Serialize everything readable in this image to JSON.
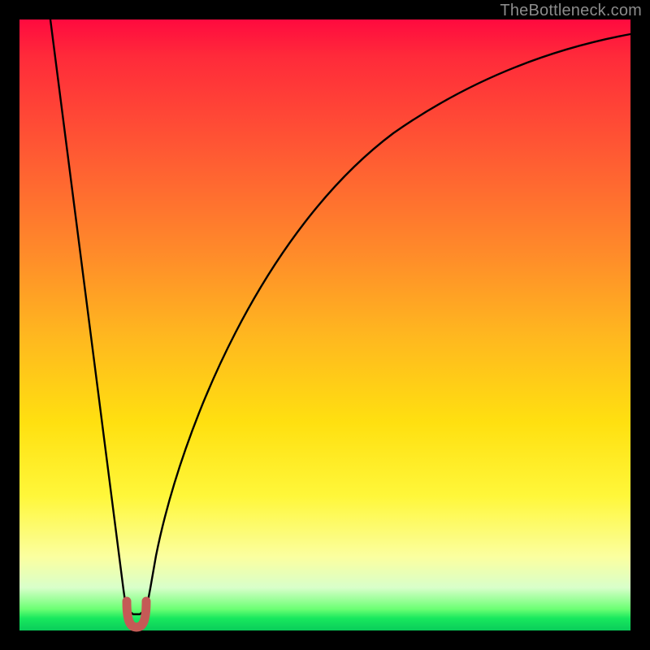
{
  "watermark": {
    "text": "TheBottleneck.com"
  },
  "colors": {
    "curve": "#000000",
    "marker": "#c45a56",
    "gradient_top": "#ff0a3f",
    "gradient_bottom": "#0acd5a"
  },
  "chart_data": {
    "type": "line",
    "title": "",
    "xlabel": "",
    "ylabel": "",
    "xlim": [
      0,
      100
    ],
    "ylim": [
      0,
      100
    ],
    "grid": false,
    "legend_position": "none",
    "annotations": [
      {
        "text": "TheBottleneck.com",
        "role": "watermark",
        "position": "top-right"
      }
    ],
    "minimum_marker": {
      "x": 19,
      "y": 2,
      "shape": "u",
      "color": "#c45a56"
    },
    "series": [
      {
        "name": "bottleneck-curve",
        "color": "#000000",
        "x": [
          5,
          8,
          11,
          14,
          16,
          17,
          18,
          19,
          20,
          21,
          22,
          24,
          27,
          31,
          36,
          42,
          50,
          60,
          72,
          86,
          100
        ],
        "values": [
          100,
          80,
          60,
          40,
          24,
          15,
          8,
          2,
          6,
          12,
          18,
          28,
          40,
          52,
          62,
          71,
          79,
          86,
          91,
          95,
          97
        ]
      }
    ],
    "background_gradient": {
      "direction": "vertical",
      "stops": [
        {
          "pos": 0.0,
          "color": "#ff0a3f"
        },
        {
          "pos": 0.22,
          "color": "#ff5a33"
        },
        {
          "pos": 0.52,
          "color": "#ffb81f"
        },
        {
          "pos": 0.78,
          "color": "#fff73a"
        },
        {
          "pos": 0.93,
          "color": "#d8ffca"
        },
        {
          "pos": 1.0,
          "color": "#0acd5a"
        }
      ]
    }
  }
}
